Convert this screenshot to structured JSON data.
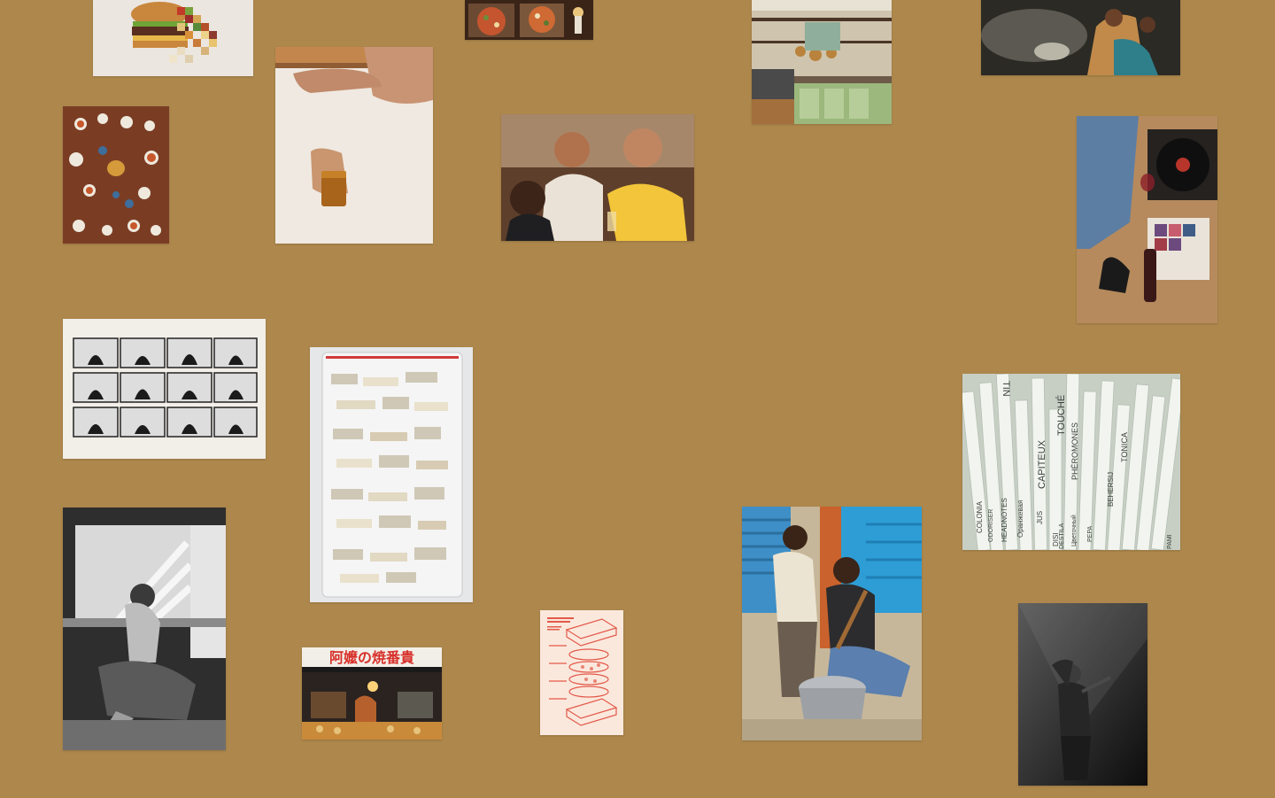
{
  "page": {
    "background": "#ad874c"
  },
  "tiles": [
    {
      "name": "burger-pixel-art"
    },
    {
      "name": "pizza-boxes-candle"
    },
    {
      "name": "green-kitchen-shelves"
    },
    {
      "name": "woman-child-smoke"
    },
    {
      "name": "feast-table-overhead"
    },
    {
      "name": "hand-amber-glass"
    },
    {
      "name": "friends-drinking-night"
    },
    {
      "name": "wine-record-player"
    },
    {
      "name": "motion-study-grid"
    },
    {
      "name": "bag-of-paper-scraps"
    },
    {
      "name": "perfume-scent-strips"
    },
    {
      "name": "woman-at-window-bw"
    },
    {
      "name": "night-market-stall"
    },
    {
      "name": "exploded-sandwich-poster"
    },
    {
      "name": "cooking-outdoors-pot"
    },
    {
      "name": "performer-spotlight-bw"
    }
  ],
  "signs": {
    "market_sign": "阿嬤の焼番貴"
  },
  "scent_words": [
    "TIN",
    "TOUCHÉ",
    "CAPITEUX",
    "PHÉROMONES",
    "BEHERSIJ",
    "TONICA",
    "COLONIA",
    "HEADNOTES",
    "Оранжевая",
    "JUS",
    "ODORISER",
    "DISI",
    "Цветочный",
    "PEPA",
    "DESTILA",
    "PAMI"
  ]
}
